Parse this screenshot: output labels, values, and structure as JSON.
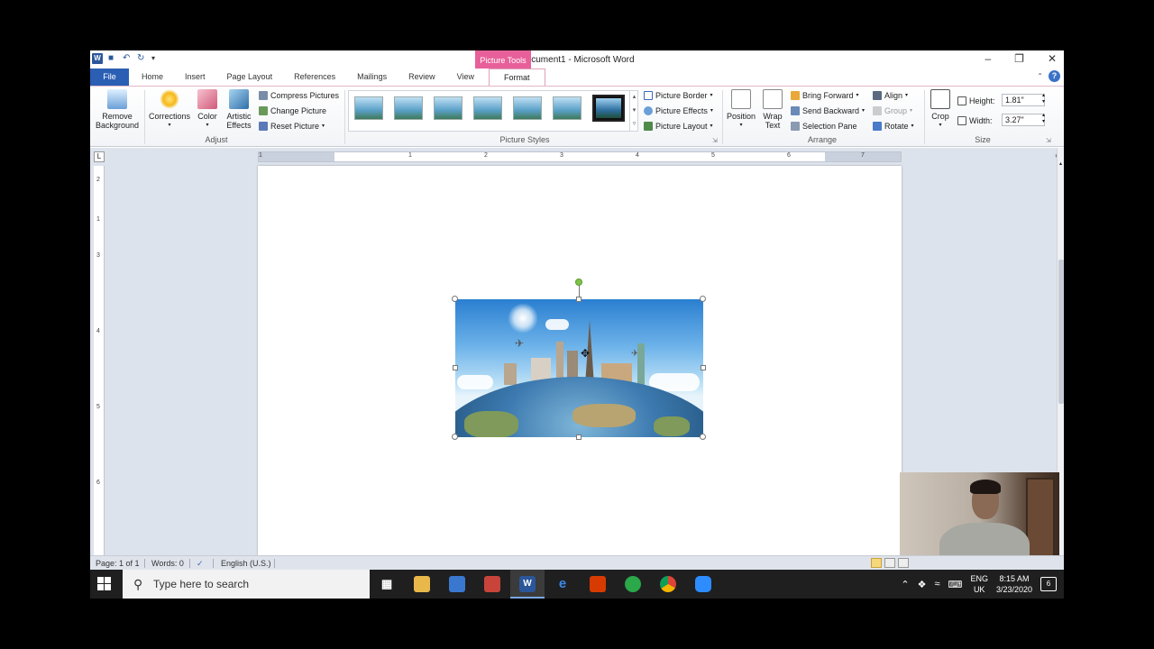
{
  "window": {
    "title": "Document1  -  Microsoft Word",
    "context_tab": "Picture Tools"
  },
  "tabs": {
    "file": "File",
    "items": [
      "Home",
      "Insert",
      "Page Layout",
      "References",
      "Mailings",
      "Review",
      "View",
      "Format"
    ],
    "active": "Format"
  },
  "ribbon": {
    "adjust": {
      "label": "Adjust",
      "remove_background_1": "Remove",
      "remove_background_2": "Background",
      "corrections": "Corrections",
      "color": "Color",
      "artistic_1": "Artistic",
      "artistic_2": "Effects",
      "compress": "Compress Pictures",
      "change": "Change Picture",
      "reset": "Reset Picture"
    },
    "styles": {
      "label": "Picture Styles",
      "border": "Picture Border",
      "effects": "Picture Effects",
      "layout": "Picture Layout"
    },
    "arrange": {
      "label": "Arrange",
      "position": "Position",
      "wrap_1": "Wrap",
      "wrap_2": "Text",
      "bring_forward": "Bring Forward",
      "send_backward": "Send Backward",
      "selection_pane": "Selection Pane",
      "align": "Align",
      "group": "Group",
      "rotate": "Rotate"
    },
    "size": {
      "label": "Size",
      "crop": "Crop",
      "height_label": "Height:",
      "height_value": "1.81\"",
      "width_label": "Width:",
      "width_value": "3.27\""
    }
  },
  "ruler": {
    "h_numbers": [
      "1",
      "1",
      "2",
      "3",
      "4",
      "5",
      "6",
      "7"
    ],
    "v_numbers": [
      "2",
      "1",
      "3",
      "4",
      "5",
      "6"
    ],
    "corner": "L"
  },
  "statusbar": {
    "page": "Page: 1 of 1",
    "words": "Words: 0",
    "language": "English (U.S.)"
  },
  "taskbar": {
    "search_placeholder": "Type here to search",
    "lang_1": "ENG",
    "lang_2": "UK",
    "time": "8:15 AM",
    "date": "3/23/2020",
    "notifications": "6"
  },
  "colors": {
    "word_blue": "#2b5fb4",
    "picture_tools_pink": "#e8609a",
    "taskbar": "#1f1f1f"
  }
}
